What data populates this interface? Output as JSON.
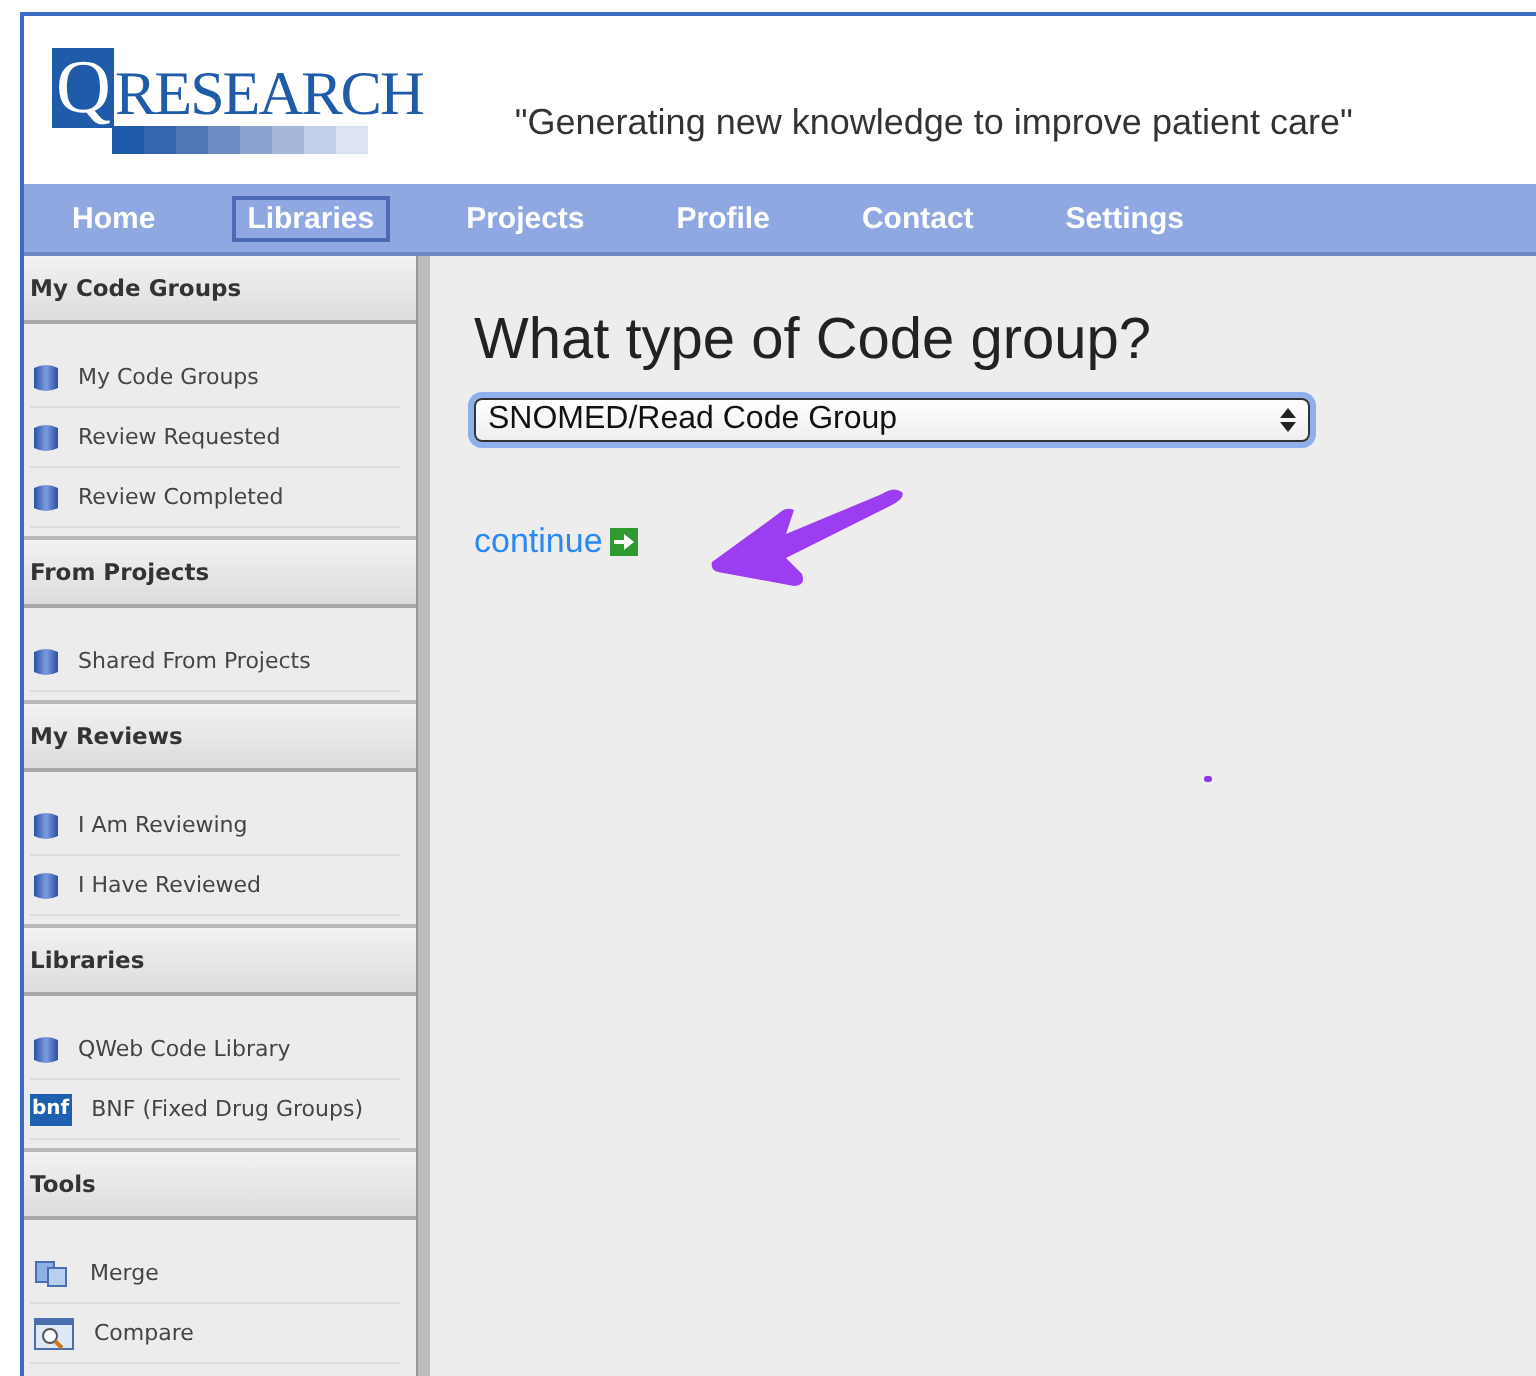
{
  "header": {
    "logo_mark": "Q",
    "logo_text": "RESEARCH",
    "tagline": "\"Generating new knowledge to improve patient care\""
  },
  "nav": [
    {
      "label": "Home",
      "selected": false
    },
    {
      "label": "Libraries",
      "selected": true
    },
    {
      "label": "Projects",
      "selected": false
    },
    {
      "label": "Profile",
      "selected": false
    },
    {
      "label": "Contact",
      "selected": false
    },
    {
      "label": "Settings",
      "selected": false
    }
  ],
  "sidebar": {
    "sections": [
      {
        "title": "My Code Groups",
        "items": [
          {
            "label": "My Code Groups",
            "kind": "database"
          },
          {
            "label": "Review Requested",
            "kind": "database"
          },
          {
            "label": "Review Completed",
            "kind": "database"
          }
        ]
      },
      {
        "title": "From Projects",
        "items": [
          {
            "label": "Shared From Projects",
            "kind": "database"
          }
        ]
      },
      {
        "title": "My Reviews",
        "items": [
          {
            "label": "I Am Reviewing",
            "kind": "database"
          },
          {
            "label": "I Have Reviewed",
            "kind": "database"
          }
        ]
      },
      {
        "title": "Libraries",
        "items": [
          {
            "label": "QWeb Code Library",
            "kind": "database"
          },
          {
            "label": "BNF (Fixed Drug Groups)",
            "kind": "bnf",
            "icon_text": "bnf"
          }
        ]
      },
      {
        "title": "Tools",
        "items": [
          {
            "label": "Merge",
            "kind": "merge"
          },
          {
            "label": "Compare",
            "kind": "compare"
          }
        ]
      }
    ]
  },
  "main": {
    "heading": "What type of Code group?",
    "select": {
      "value": "SNOMED/Read Code Group"
    },
    "link": "continue"
  }
}
